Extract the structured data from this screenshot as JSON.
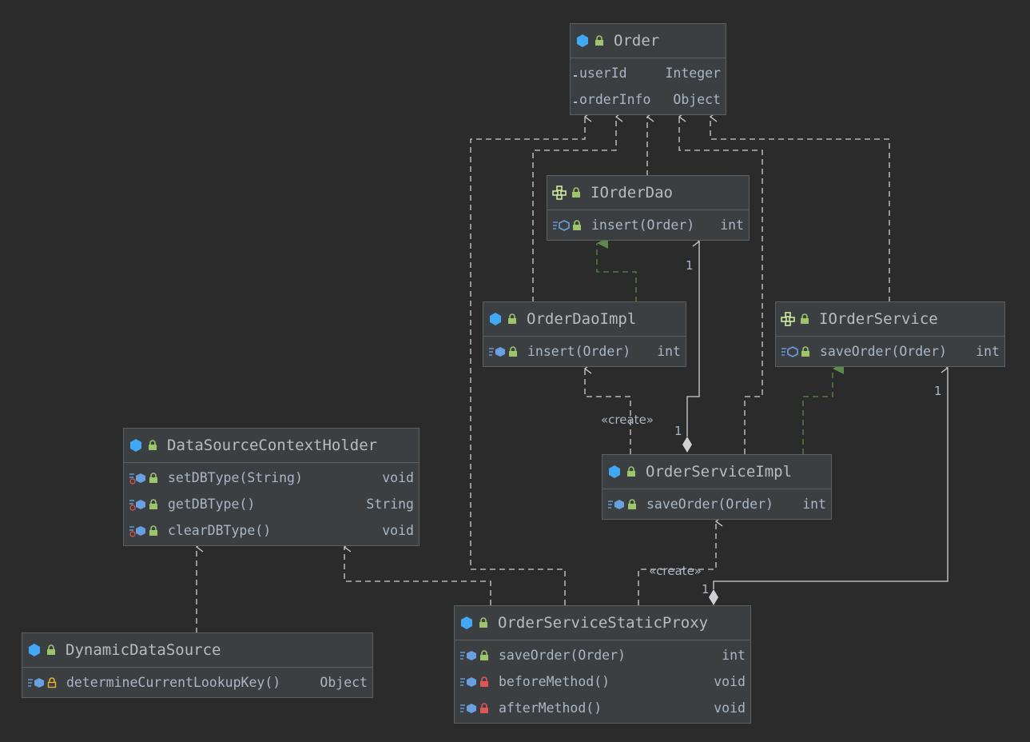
{
  "classes": {
    "order": {
      "title": "Order",
      "kind": "class",
      "fields": [
        {
          "name": "userId",
          "type": "Integer"
        },
        {
          "name": "orderInfo",
          "type": "Object"
        }
      ]
    },
    "iorderdao": {
      "title": "IOrderDao",
      "kind": "interface",
      "methods": [
        {
          "name": "insert(Order)",
          "type": "int",
          "access": "public"
        }
      ]
    },
    "orderdaoimpl": {
      "title": "OrderDaoImpl",
      "kind": "class",
      "methods": [
        {
          "name": "insert(Order)",
          "type": "int",
          "access": "public"
        }
      ]
    },
    "iorderservice": {
      "title": "IOrderService",
      "kind": "interface",
      "methods": [
        {
          "name": "saveOrder(Order)",
          "type": "int",
          "access": "public"
        }
      ]
    },
    "orderserviceimpl": {
      "title": "OrderServiceImpl",
      "kind": "class",
      "methods": [
        {
          "name": "saveOrder(Order)",
          "type": "int",
          "access": "public"
        }
      ]
    },
    "datasourcecontextholder": {
      "title": "DataSourceContextHolder",
      "kind": "class",
      "methods": [
        {
          "name": "setDBType(String)",
          "type": "void",
          "access": "public",
          "static": true
        },
        {
          "name": "getDBType()",
          "type": "String",
          "access": "public",
          "static": true
        },
        {
          "name": "clearDBType()",
          "type": "void",
          "access": "public",
          "static": true
        }
      ]
    },
    "dynamicdatasource": {
      "title": "DynamicDataSource",
      "kind": "class",
      "methods": [
        {
          "name": "determineCurrentLookupKey()",
          "type": "Object",
          "access": "protected"
        }
      ]
    },
    "orderservicestaticproxy": {
      "title": "OrderServiceStaticProxy",
      "kind": "class",
      "methods": [
        {
          "name": "saveOrder(Order)",
          "type": "int",
          "access": "public"
        },
        {
          "name": "beforeMethod()",
          "type": "void",
          "access": "private"
        },
        {
          "name": "afterMethod()",
          "type": "void",
          "access": "private"
        }
      ]
    }
  },
  "labels": {
    "create_1": "«create»",
    "create_2": "«create»",
    "mult_iorderdao": "1",
    "mult_orderserviceimpl": "1",
    "mult_iorderservice": "1",
    "mult_proxy": "1"
  },
  "colors": {
    "background": "#2b2b2b",
    "box": "#3c3f41",
    "dependency": "#cfcfcf",
    "realization": "#5c8a4a",
    "class_icon": "#40a8f5",
    "interface_icon": "#d0e8a0",
    "lock_public": "#9dc56b",
    "lock_private": "#e05555",
    "lock_protected": "#e8b030"
  }
}
